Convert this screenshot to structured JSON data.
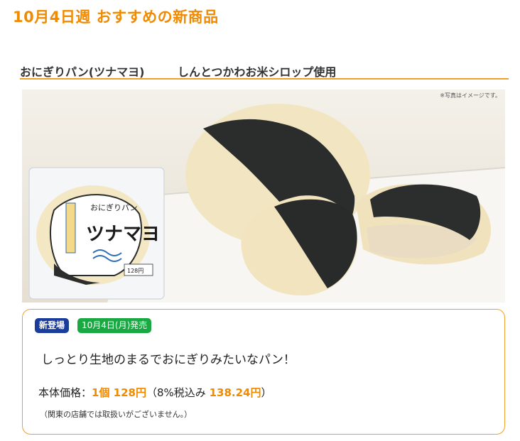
{
  "page": {
    "title": "10月4日週 おすすめの新商品"
  },
  "product": {
    "name": "おにぎりパン(ツナマヨ)",
    "catch": "しんとつかわお米シロップ使用",
    "image_note": "※写真はイメージです。",
    "package_text": "おにぎりパン",
    "package_flavor": "ツナマヨ",
    "package_price": "128円",
    "badges": {
      "new": "新登場",
      "release": "10月4日(月)発売"
    },
    "description": "しっとり生地のまるでおにぎりみたいなパン！",
    "price": {
      "prefix": "本体価格：",
      "unit_price": "1個 128円",
      "tax_open": "（8%税込み ",
      "tax_price": "138.24円",
      "tax_close": "）"
    },
    "notice": "（関東の店舗では取扱いがございません。）"
  },
  "colors": {
    "accent": "#f08a00",
    "border": "#f0a02a",
    "badge_new": "#1a3c9a",
    "badge_release": "#1aa842"
  }
}
